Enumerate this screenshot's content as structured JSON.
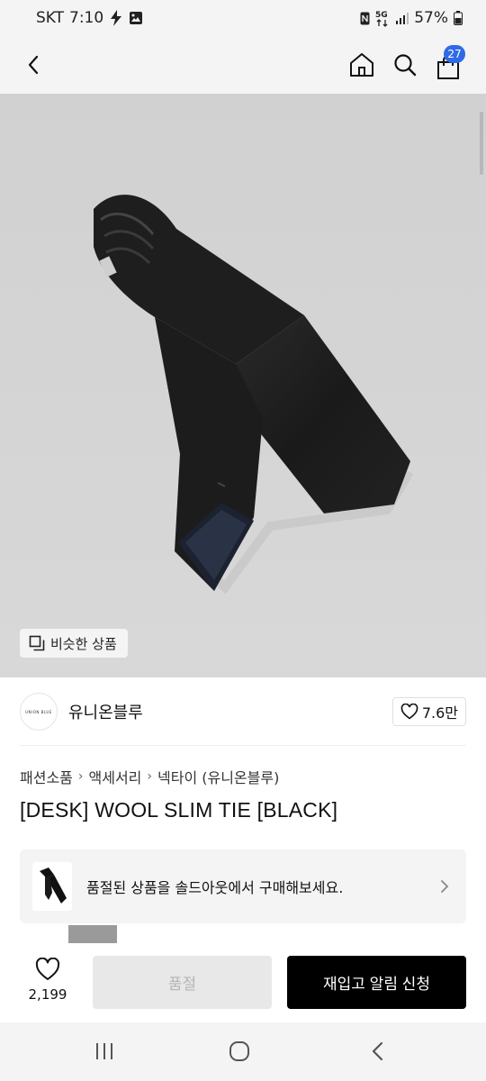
{
  "status": {
    "carrier": "SKT",
    "time": "7:10",
    "network": "5G",
    "battery": "57%"
  },
  "appbar": {
    "cart_count": "27"
  },
  "hero": {
    "similar_label": "비슷한 상품"
  },
  "brand": {
    "logo_text": "UNION BLUE",
    "name": "유니온블루",
    "likes": "7.6만"
  },
  "breadcrumb": [
    "패션소품",
    "액세서리",
    "넥타이 (유니온블루)"
  ],
  "product": {
    "title": "[DESK] WOOL SLIM TIE [BLACK]"
  },
  "soldout_banner": {
    "text": "품절된 상품을 솔드아웃에서 구매해보세요."
  },
  "purchase_bar": {
    "wish_count": "2,199",
    "soldout_label": "품절",
    "restock_label": "재입고 알림 신청"
  },
  "colors": {
    "badge_blue": "#2f6be6",
    "primary_black": "#000000",
    "disabled_gray": "#e8e8e8"
  }
}
